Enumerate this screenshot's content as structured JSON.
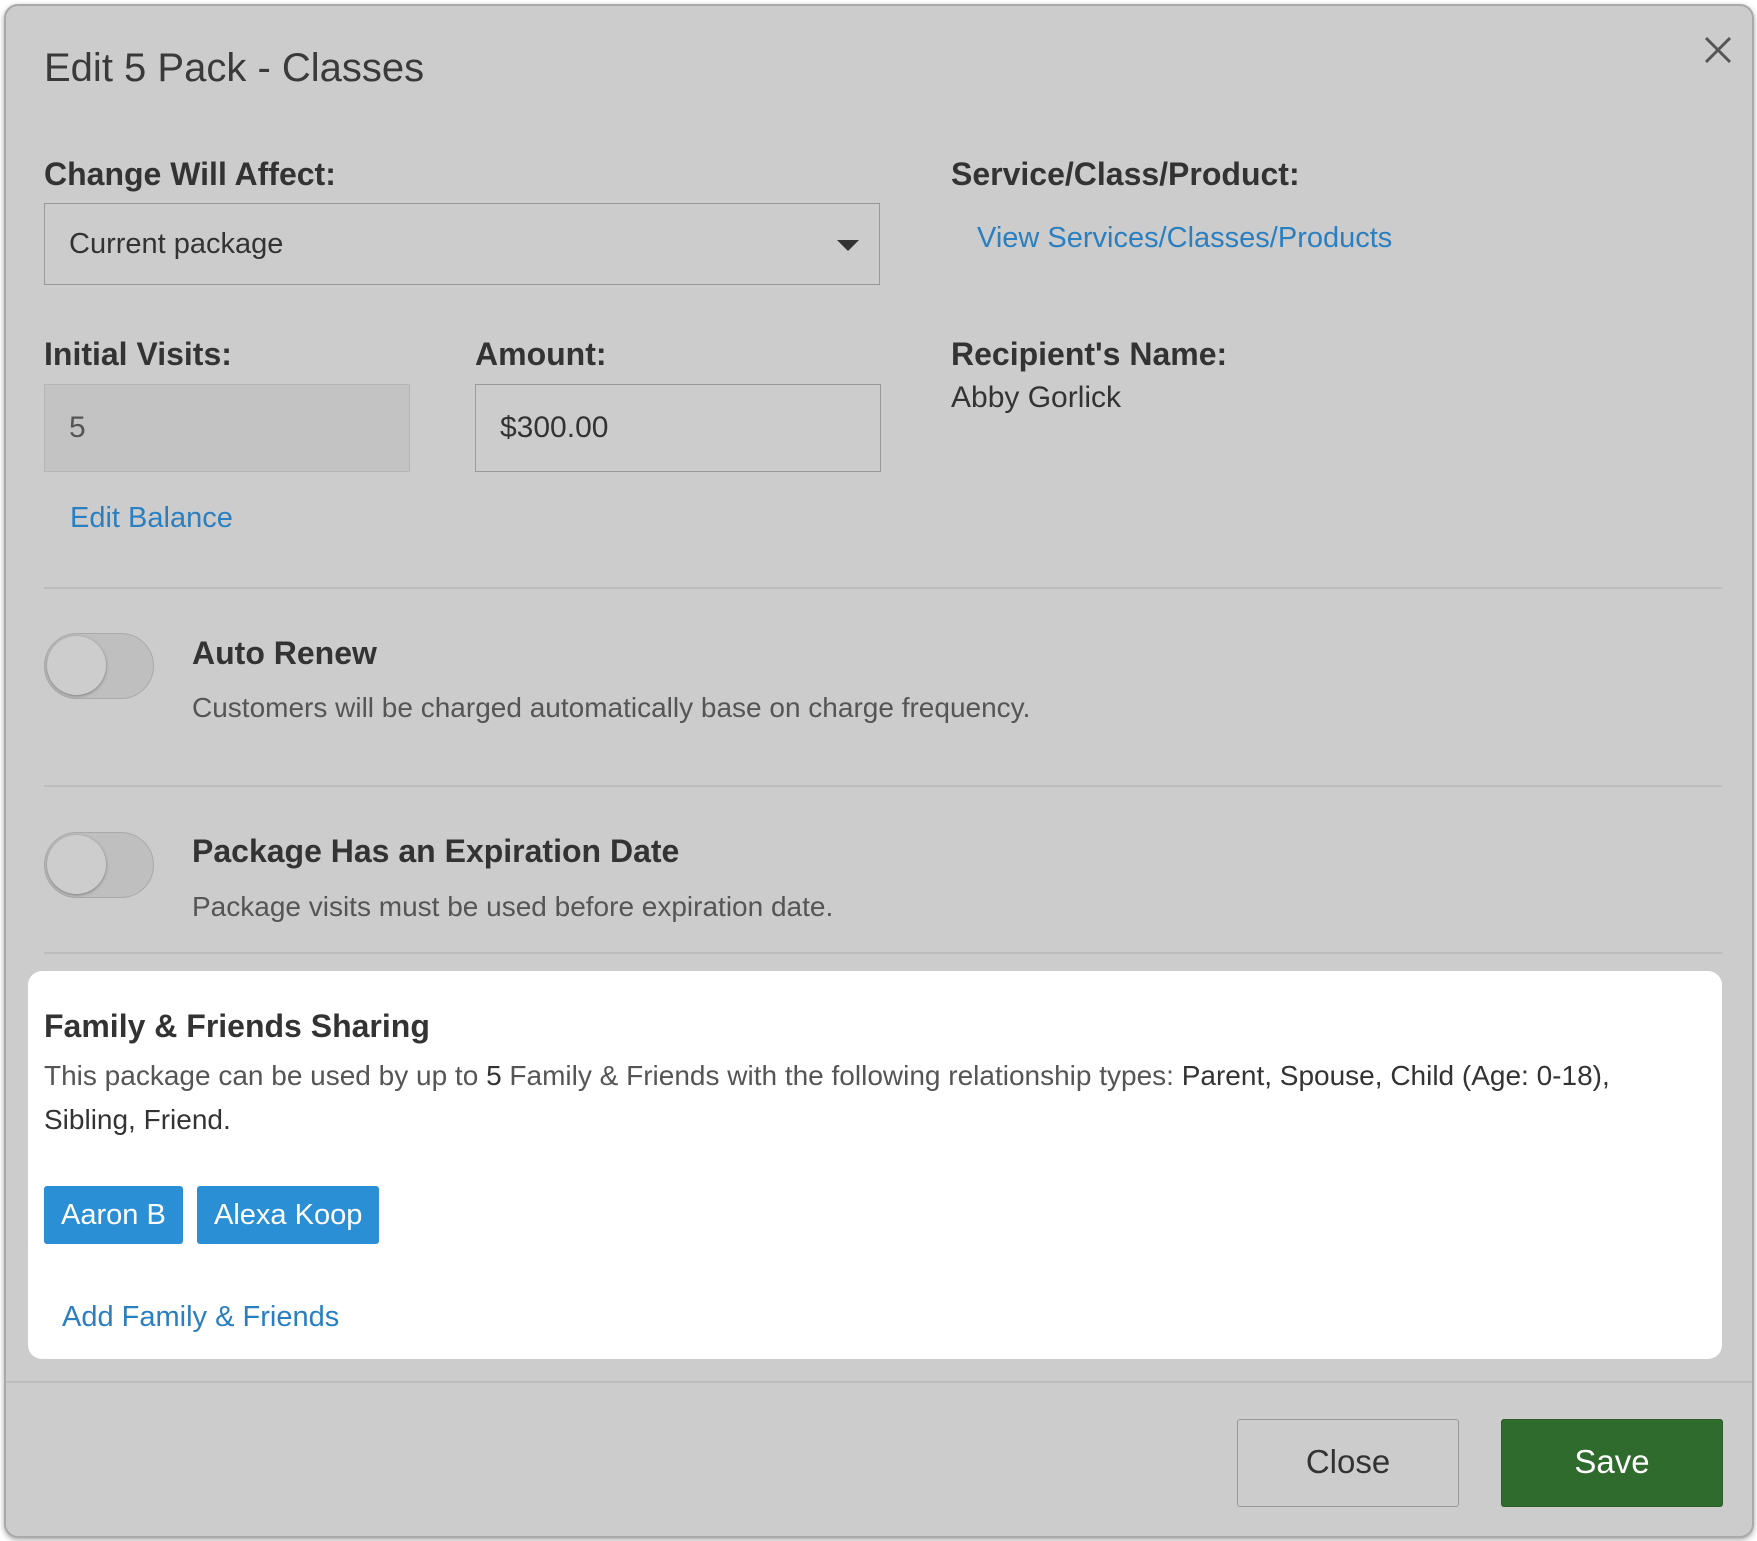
{
  "modal": {
    "title": "Edit 5 Pack - Classes"
  },
  "change_affect": {
    "label": "Change Will Affect:",
    "selected": "Current package"
  },
  "service": {
    "label": "Service/Class/Product:",
    "link": "View Services/Classes/Products"
  },
  "initial_visits": {
    "label": "Initial Visits:",
    "value": "5",
    "edit_link": "Edit Balance"
  },
  "amount": {
    "label": "Amount:",
    "value": "$300.00"
  },
  "recipient": {
    "label": "Recipient's Name:",
    "name": "Abby Gorlick"
  },
  "auto_renew": {
    "title": "Auto Renew",
    "description": "Customers will be charged automatically base on charge frequency.",
    "enabled": false
  },
  "expiration": {
    "title": "Package Has an Expiration Date",
    "description": "Package visits must be used before expiration date.",
    "enabled": false
  },
  "sharing": {
    "title": "Family & Friends Sharing",
    "desc_prefix": "This package can be used by up to ",
    "count": "5",
    "desc_middle": " Family & Friends with the following relationship types: ",
    "relationship_types": "Parent, Spouse, Child (Age: 0-18), Sibling, Friend.",
    "members": [
      "Aaron B",
      "Alexa Koop"
    ],
    "add_link": "Add Family & Friends"
  },
  "footer": {
    "close_label": "Close",
    "save_label": "Save"
  },
  "colors": {
    "link": "#2a7fc1",
    "tag": "#2b8fd6",
    "save": "#2e6b2c"
  },
  "icons": {
    "close": "close-icon",
    "dropdown": "chevron-down-icon"
  }
}
